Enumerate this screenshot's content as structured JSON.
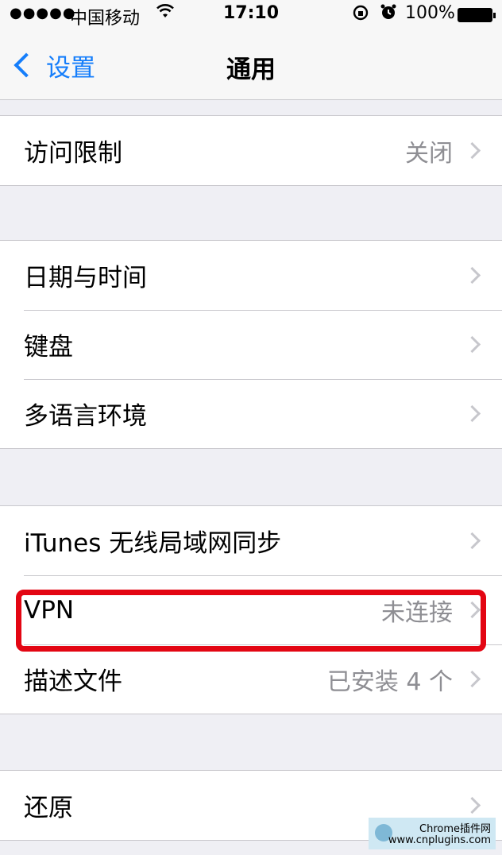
{
  "status_bar": {
    "signal": "●●●●●",
    "carrier": "中国移动",
    "time": "17:10",
    "battery_percent": "100%"
  },
  "nav": {
    "back_label": "设置",
    "title": "通用"
  },
  "groups": [
    {
      "rows": [
        {
          "label": "访问限制",
          "detail": "关闭"
        }
      ]
    },
    {
      "rows": [
        {
          "label": "日期与时间",
          "detail": ""
        },
        {
          "label": "键盘",
          "detail": ""
        },
        {
          "label": "多语言环境",
          "detail": ""
        }
      ]
    },
    {
      "rows": [
        {
          "label": "iTunes 无线局域网同步",
          "detail": ""
        },
        {
          "label": "VPN",
          "detail": "未连接"
        },
        {
          "label": "描述文件",
          "detail": "已安装 4 个"
        }
      ]
    },
    {
      "rows": [
        {
          "label": "还原",
          "detail": ""
        }
      ]
    }
  ],
  "watermark": {
    "line1": "Chrome插件网",
    "line2": "www.cnplugins.com"
  },
  "colors": {
    "accent": "#157efb",
    "highlight": "#e30613",
    "background": "#efeff4"
  },
  "icons": {
    "wifi": "wifi-icon",
    "lock": "orientation-lock-icon",
    "alarm": "alarm-icon",
    "battery": "battery-icon",
    "back": "chevron-left-icon",
    "disclosure": "chevron-right-icon"
  }
}
